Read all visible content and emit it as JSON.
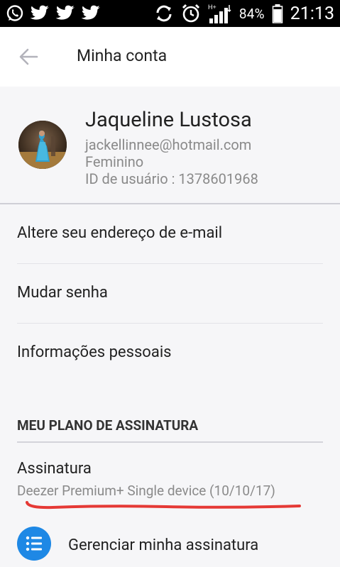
{
  "status_bar": {
    "icons_left": [
      "whatsapp-icon",
      "twitter-icon",
      "twitter-icon",
      "twitter-icon"
    ],
    "icons_right": [
      "sync-icon",
      "alarm-icon",
      "signal-icon",
      "battery-icon"
    ],
    "network": "H+",
    "battery": "84%",
    "time": "21:13"
  },
  "appbar": {
    "title": "Minha conta"
  },
  "profile": {
    "name": "Jaqueline Lustosa",
    "email": "jackellinnee@hotmail.com",
    "gender": "Feminino",
    "user_id": "ID de usuário : 1378601968"
  },
  "menu": {
    "items": [
      {
        "label": "Altere seu endereço de e-mail"
      },
      {
        "label": "Mudar senha"
      },
      {
        "label": "Informações pessoais"
      }
    ]
  },
  "subscription": {
    "section_title": "MEU PLANO DE ASSINATURA",
    "title": "Assinatura",
    "plan": "Deezer Premium+ Single device (10/10/17)",
    "manage_label": "Gerenciar minha assinatura"
  },
  "colors": {
    "accent": "#1e88e5",
    "annotation": "#e53935"
  }
}
